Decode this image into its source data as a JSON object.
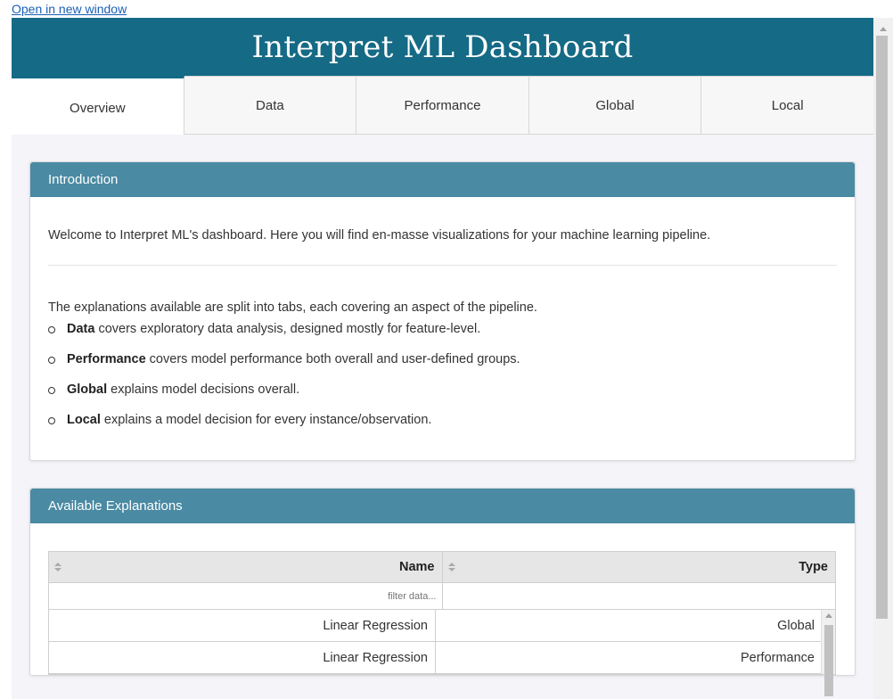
{
  "link": {
    "open_new_window": "Open in new window"
  },
  "banner": {
    "title": "Interpret ML Dashboard",
    "color": "#156a85"
  },
  "tabs": [
    {
      "label": "Overview",
      "active": true
    },
    {
      "label": "Data",
      "active": false
    },
    {
      "label": "Performance",
      "active": false
    },
    {
      "label": "Global",
      "active": false
    },
    {
      "label": "Local",
      "active": false
    }
  ],
  "introduction": {
    "header": "Introduction",
    "welcome": "Welcome to Interpret ML's dashboard. Here you will find en-masse visualizations for your machine learning pipeline.",
    "split_text": "The explanations available are split into tabs, each covering an aspect of the pipeline.",
    "bullets": [
      {
        "bold": "Data",
        "rest": " covers exploratory data analysis, designed mostly for feature-level."
      },
      {
        "bold": "Performance",
        "rest": " covers model performance both overall and user-defined groups."
      },
      {
        "bold": "Global",
        "rest": " explains model decisions overall."
      },
      {
        "bold": "Local",
        "rest": " explains a model decision for every instance/observation."
      }
    ]
  },
  "explanations": {
    "header": "Available Explanations",
    "columns": [
      "Name",
      "Type"
    ],
    "filter_placeholder": "filter data...",
    "rows": [
      {
        "name": "Linear Regression",
        "type": "Global"
      },
      {
        "name": "Linear Regression",
        "type": "Performance"
      }
    ]
  },
  "colors": {
    "card_header": "#4a8aa3",
    "background": "#f4f4f9"
  }
}
